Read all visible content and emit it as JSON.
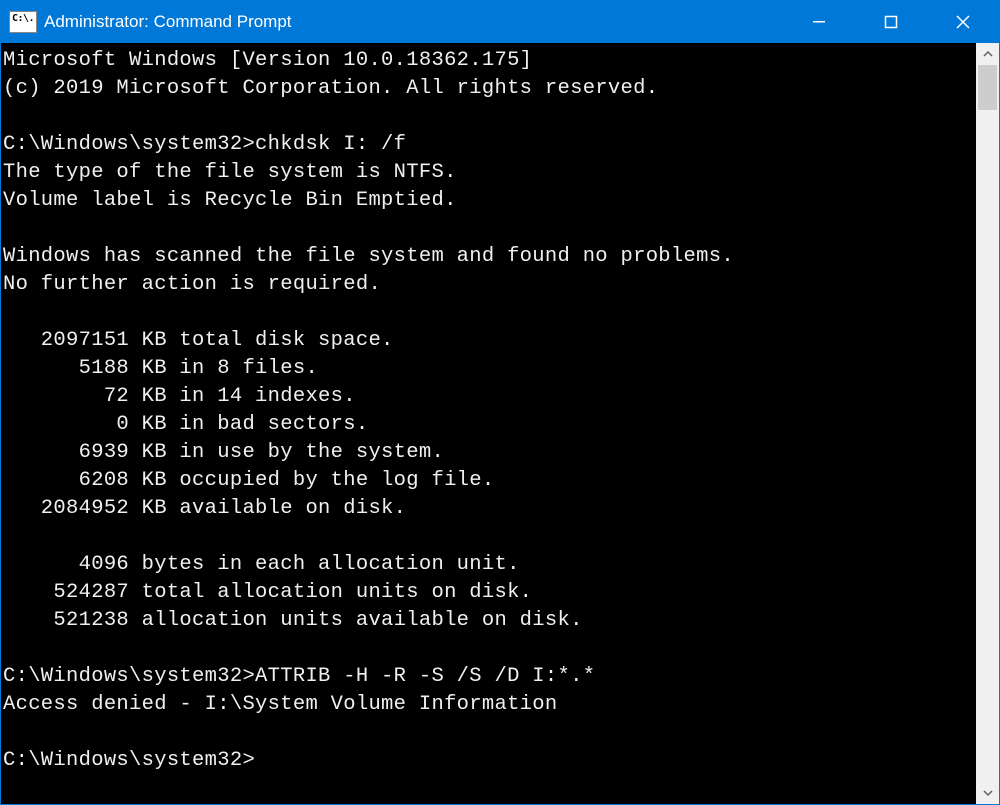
{
  "window": {
    "title": "Administrator: Command Prompt",
    "icon_text": "C:\\."
  },
  "terminal": {
    "lines": [
      "Microsoft Windows [Version 10.0.18362.175]",
      "(c) 2019 Microsoft Corporation. All rights reserved.",
      "",
      "C:\\Windows\\system32>chkdsk I: /f",
      "The type of the file system is NTFS.",
      "Volume label is Recycle Bin Emptied.",
      "",
      "Windows has scanned the file system and found no problems.",
      "No further action is required.",
      "",
      "   2097151 KB total disk space.",
      "      5188 KB in 8 files.",
      "        72 KB in 14 indexes.",
      "         0 KB in bad sectors.",
      "      6939 KB in use by the system.",
      "      6208 KB occupied by the log file.",
      "   2084952 KB available on disk.",
      "",
      "      4096 bytes in each allocation unit.",
      "    524287 total allocation units on disk.",
      "    521238 allocation units available on disk.",
      "",
      "C:\\Windows\\system32>ATTRIB -H -R -S /S /D I:*.*",
      "Access denied - I:\\System Volume Information",
      "",
      "C:\\Windows\\system32>"
    ]
  }
}
